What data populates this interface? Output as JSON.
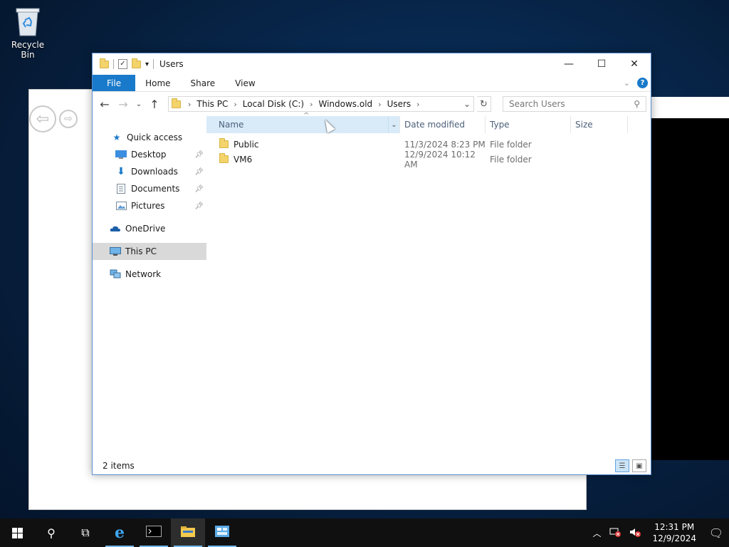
{
  "desktop": {
    "recycle_bin_label": "Recycle Bin"
  },
  "explorer": {
    "title": "Users",
    "window_controls": {
      "minimize": "—",
      "maximize": "☐",
      "close": "✕"
    },
    "ribbon": {
      "tabs": [
        "File",
        "Home",
        "Share",
        "View"
      ],
      "help": "?"
    },
    "address": {
      "crumbs": [
        "This PC",
        "Local Disk (C:)",
        "Windows.old",
        "Users"
      ]
    },
    "search": {
      "placeholder": "Search Users"
    },
    "nav": {
      "quick_access": "Quick access",
      "desktop": "Desktop",
      "downloads": "Downloads",
      "documents": "Documents",
      "pictures": "Pictures",
      "onedrive": "OneDrive",
      "this_pc": "This PC",
      "network": "Network"
    },
    "columns": {
      "name": "Name",
      "date": "Date modified",
      "type": "Type",
      "size": "Size"
    },
    "files": [
      {
        "name": "Public",
        "date": "11/3/2024 8:23 PM",
        "type": "File folder"
      },
      {
        "name": "VM6",
        "date": "12/9/2024 10:12 AM",
        "type": "File folder"
      }
    ],
    "status": "2 items"
  },
  "taskbar": {
    "time": "12:31 PM",
    "date": "12/9/2024"
  },
  "colors": {
    "accent": "#1979ca",
    "selected_header": "#d9ebf9",
    "folder": "#f3d36a"
  }
}
